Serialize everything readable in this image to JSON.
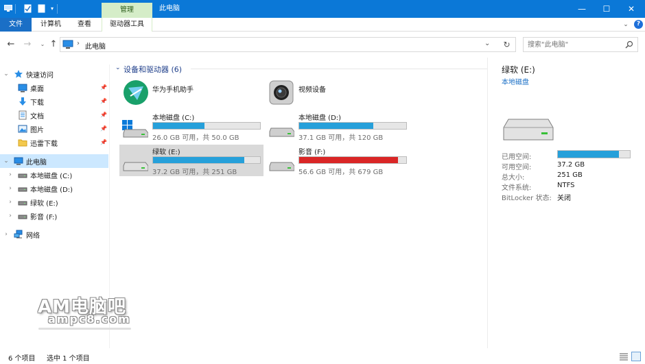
{
  "window": {
    "manage_tab": "管理",
    "title": "此电脑",
    "minimize": "—",
    "maximize": "☐",
    "close": "✕",
    "accent": "#0b78d7",
    "context_tab_color": "#d5edc8"
  },
  "ribbon": {
    "file": "文件",
    "computer": "计算机",
    "view": "查看",
    "drive_tools": "驱动器工具",
    "expand": "⌄",
    "help": "?"
  },
  "address": {
    "path": "此电脑",
    "separator": "›",
    "dropdown": "⌄",
    "refresh": "↻",
    "search_placeholder": "搜索\"此电脑\""
  },
  "sidebar": {
    "items": [
      {
        "label": "快速访问",
        "icon": "star-icon",
        "expandable": true,
        "expanded": true
      },
      {
        "label": "桌面",
        "icon": "desktop-icon",
        "pinned": true
      },
      {
        "label": "下载",
        "icon": "download-icon",
        "pinned": true
      },
      {
        "label": "文档",
        "icon": "document-icon",
        "pinned": true
      },
      {
        "label": "图片",
        "icon": "picture-icon",
        "pinned": true
      },
      {
        "label": "迅雷下载",
        "icon": "folder-icon",
        "pinned": true
      },
      {
        "label": "此电脑",
        "icon": "computer-icon",
        "expandable": true,
        "expanded": true,
        "selected": true
      },
      {
        "label": "本地磁盘 (C:)",
        "icon": "drive-icon",
        "expandable": true
      },
      {
        "label": "本地磁盘 (D:)",
        "icon": "drive-icon",
        "expandable": true
      },
      {
        "label": "绿软 (E:)",
        "icon": "drive-icon",
        "expandable": true
      },
      {
        "label": "影音 (F:)",
        "icon": "drive-icon",
        "expandable": true
      },
      {
        "label": "网络",
        "icon": "network-icon",
        "expandable": true
      }
    ]
  },
  "main": {
    "group_label": "设备和驱动器 (6)",
    "devices": [
      {
        "name": "华为手机助手",
        "icon": "huawei-assistant-icon"
      },
      {
        "name": "视频设备",
        "icon": "camera-icon"
      }
    ],
    "drives": [
      {
        "name": "本地磁盘 (C:)",
        "info": "26.0 GB 可用，共 50.0 GB",
        "used_fraction": 0.48,
        "color": "#26a0da",
        "system": true
      },
      {
        "name": "本地磁盘 (D:)",
        "info": "37.1 GB 可用，共 120 GB",
        "used_fraction": 0.69,
        "color": "#26a0da"
      },
      {
        "name": "绿软 (E:)",
        "info": "37.2 GB 可用，共 251 GB",
        "used_fraction": 0.85,
        "color": "#26a0da",
        "selected": true
      },
      {
        "name": "影音 (F:)",
        "info": "56.6 GB 可用，共 679 GB",
        "used_fraction": 0.92,
        "color": "#da2626"
      }
    ]
  },
  "details": {
    "title": "绿软 (E:)",
    "subtitle": "本地磁盘",
    "used_label": "已用空间:",
    "used_fraction": 0.85,
    "free_label": "可用空间:",
    "free_value": "37.2 GB",
    "total_label": "总大小:",
    "total_value": "251 GB",
    "fs_label": "文件系统:",
    "fs_value": "NTFS",
    "bitlocker_label": "BitLocker 状态:",
    "bitlocker_value": "关闭"
  },
  "watermark": {
    "text": "AM电脑吧",
    "url": "ampc8.com"
  },
  "status": {
    "count": "6 个项目",
    "selection": "选中 1 个项目"
  }
}
